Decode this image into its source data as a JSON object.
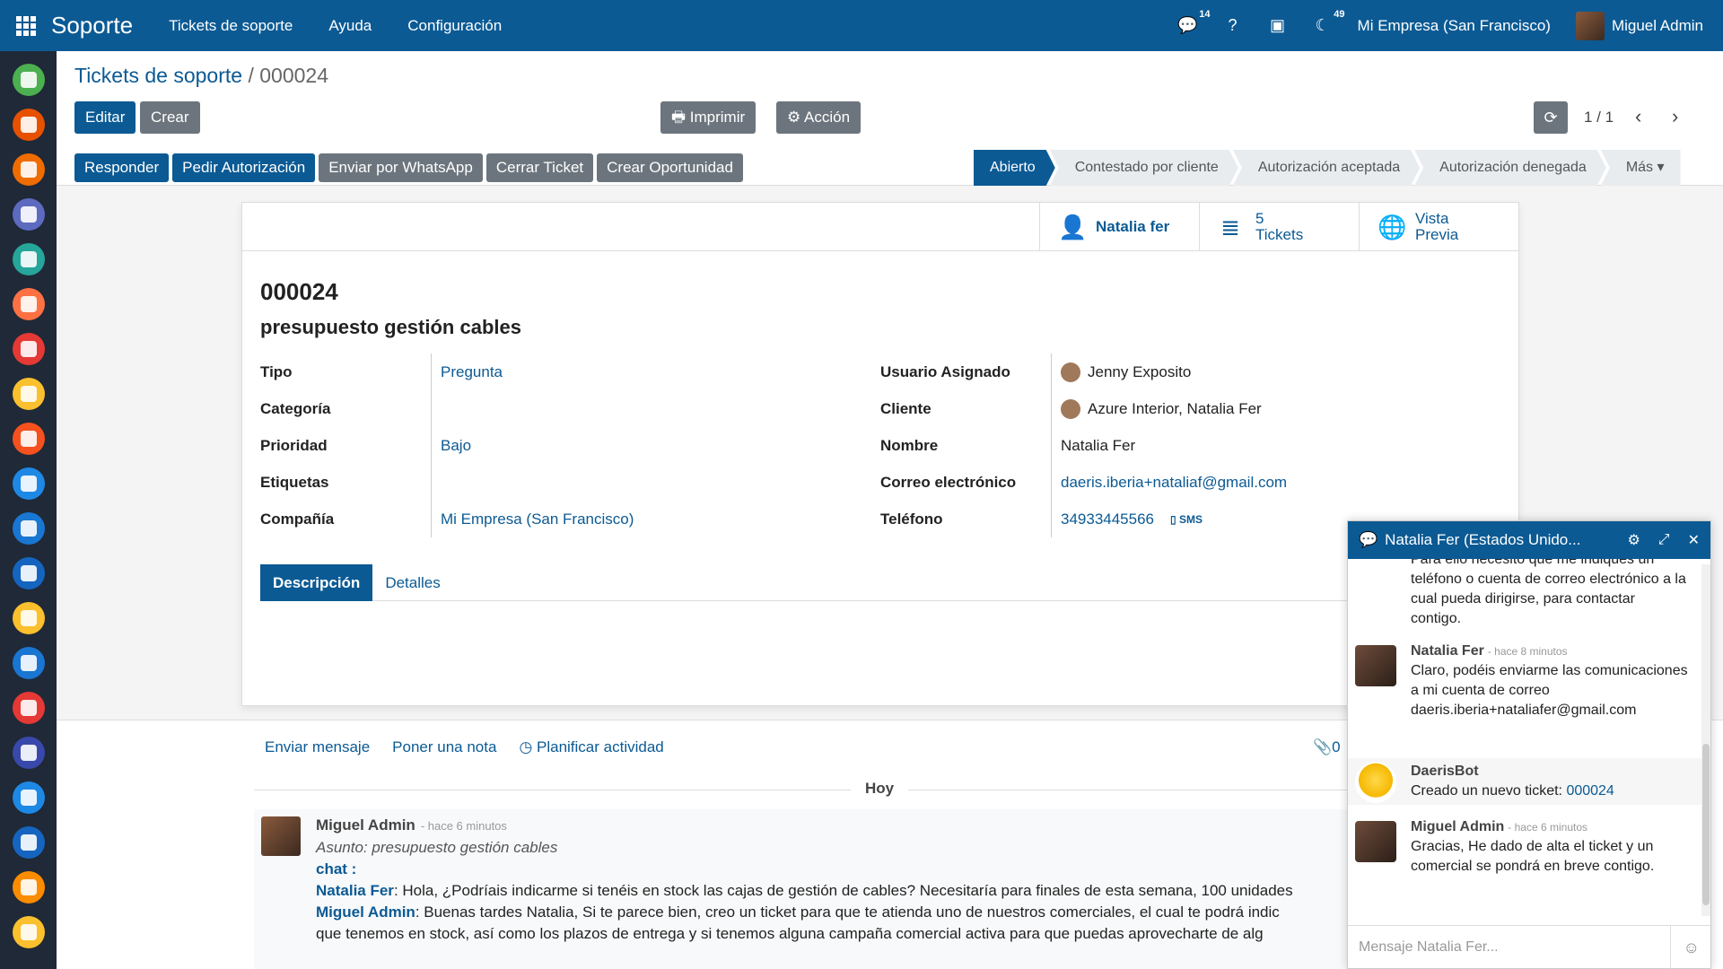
{
  "navbar": {
    "brand": "Soporte",
    "menu": [
      "Tickets de soporte",
      "Ayuda",
      "Configuración"
    ],
    "chat_badge": "14",
    "activity_badge": "49",
    "company": "Mi Empresa (San Francisco)",
    "user": "Miguel Admin"
  },
  "appbar": {
    "colors": [
      "#4caf50",
      "#e65100",
      "#ef6c00",
      "#5c6bc0",
      "#26a69a",
      "#ff7043",
      "#e53935",
      "#fbc02d",
      "#f4511e",
      "#1e88e5",
      "#1976d2",
      "#1565c0",
      "#fbc02d",
      "#1976d2",
      "#e53935",
      "#3949ab",
      "#1e88e5",
      "#1565c0",
      "#fb8c00",
      "#fbc02d"
    ]
  },
  "breadcrumb": {
    "parent": "Tickets de soporte",
    "sep": " / ",
    "current": "000024"
  },
  "buttons": {
    "edit": "Editar",
    "create": "Crear",
    "print": "Imprimir",
    "action": "Acción"
  },
  "pager": {
    "value": "1 / 1"
  },
  "status_actions": [
    "Responder",
    "Pedir Autorización",
    "Enviar por WhatsApp",
    "Cerrar Ticket",
    "Crear Oportunidad"
  ],
  "stages": {
    "s1": "Abierto",
    "s2": "Contestado por cliente",
    "s3": "Autorización aceptada",
    "s4": "Autorización denegada",
    "more": "Más"
  },
  "smart": {
    "customer": "Natalia fer",
    "tickets_count": "5",
    "tickets_label": "Tickets",
    "preview_line1": "Vista",
    "preview_line2": "Previa"
  },
  "ticket": {
    "ref": "000024",
    "subject": "presupuesto gestión cables",
    "left": {
      "tipo_label": "Tipo",
      "tipo": "Pregunta",
      "categoria_label": "Categoría",
      "categoria": "",
      "prioridad_label": "Prioridad",
      "prioridad": "Bajo",
      "etiquetas_label": "Etiquetas",
      "etiquetas": "",
      "compania_label": "Compañía",
      "compania": "Mi Empresa (San Francisco)"
    },
    "right": {
      "usuario_label": "Usuario Asignado",
      "usuario": "Jenny Exposito",
      "cliente_label": "Cliente",
      "cliente": "Azure Interior, Natalia Fer",
      "nombre_label": "Nombre",
      "nombre": "Natalia Fer",
      "correo_label": "Correo electrónico",
      "correo": "daeris.iberia+nataliaf@gmail.com",
      "telefono_label": "Teléfono",
      "telefono": "34933445566",
      "sms": "SMS"
    }
  },
  "tabs": {
    "descripcion": "Descripción",
    "detalles": "Detalles"
  },
  "chatter": {
    "send": "Enviar mensaje",
    "note": "Poner una nota",
    "schedule": "Planificar actividad",
    "attachments": "0",
    "today": "Hoy",
    "message": {
      "author": "Miguel Admin",
      "time": "- hace 6 minutos",
      "subject": "Asunto: presupuesto gestión cables",
      "chat_label": "chat :",
      "line1_name": "Natalia Fer",
      "line1": ": Hola, ¿Podríais indicarme si tenéis en stock las cajas de gestión de cables? Necesitaría para finales de esta semana, 100 unidades",
      "line2_name": "Miguel Admin",
      "line2": ": Buenas tardes Natalia, Si te parece bien, creo un ticket para que te atienda uno de nuestros comerciales, el cual te podrá indic",
      "line3": "que tenemos en stock, así como los plazos de entrega y si tenemos alguna campaña comercial activa para que puedas aprovecharte de alg"
    }
  },
  "chatwin": {
    "title": "Natalia Fer (Estados Unido...",
    "m0": "Para ello necesito que me indiques un teléfono o cuenta de correo electrónico a la cual pueda dirigirse, para contactar contigo.",
    "m1_author": "Natalia Fer",
    "m1_time": "- hace 8 minutos",
    "m1": "Claro, podéis enviarme las comunicaciones a mi cuenta de correo daeris.iberia+nataliafer@gmail.com",
    "m2_author": "DaerisBot",
    "m2": "Creado un nuevo ticket: ",
    "m2_link": "000024",
    "m3_author": "Miguel Admin",
    "m3_time": "- hace 6 minutos",
    "m3": "Gracias, He dado de alta el ticket y un comercial se pondrá en breve contigo.",
    "placeholder": "Mensaje Natalia Fer..."
  }
}
